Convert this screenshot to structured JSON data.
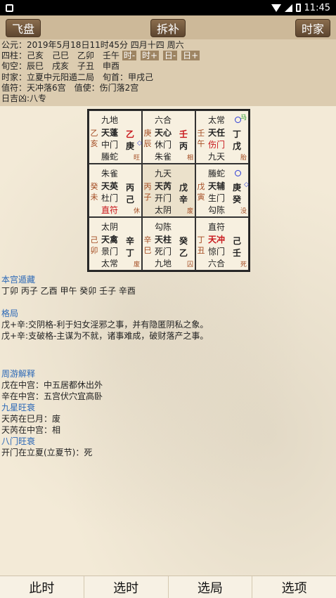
{
  "status": {
    "time": "11:45"
  },
  "topbar": {
    "left_btn": "飞盘",
    "center_btn": "拆补",
    "right_btn": "时家"
  },
  "info": {
    "line1": "公元：2019年5月18日11时45分 四月十四 周六",
    "line2_label": "四柱：己亥　己巳　乙卯　壬午",
    "tags": [
      "时-",
      "时+",
      "日-",
      "日+"
    ],
    "line3": "旬空：辰巳　戌亥　子丑　申酉",
    "line4": "时家：立夏中元阳遁二局　旬首：甲戌己",
    "line5": "值符：天冲落6宫　值使：伤门落2宫",
    "line6": "日吉凶:八专"
  },
  "grid": [
    {
      "side": [
        "乙",
        "亥"
      ],
      "r1": "九地",
      "r2": "天蓬",
      "k2": "乙",
      "r3": "中门",
      "k3": "庚",
      "r4": "螣蛇",
      "status": "旺"
    },
    {
      "side": [
        "庚",
        "辰"
      ],
      "r1": "六合",
      "r2": "天心",
      "k2": "壬",
      "r3": "休门",
      "k3": "丙",
      "r4": "朱雀",
      "status": "相"
    },
    {
      "side": [
        "壬",
        "午"
      ],
      "r1": "太常",
      "r2": "天任",
      "k2": "丁",
      "r3": "伤门",
      "k3": "戊",
      "r4": "九天",
      "status": "胎"
    },
    {
      "side": [
        "癸",
        "未"
      ],
      "r1": "朱雀",
      "r2": "天英",
      "k2": "丙",
      "r3": "杜门",
      "k3": "己",
      "r4": "直符",
      "status": "休"
    },
    {
      "side": [
        "丙",
        "子"
      ],
      "r1": "九天",
      "r2": "天芮",
      "k2": "戊",
      "r3": "开门",
      "k3": "辛",
      "r4": "太阴",
      "status": "废"
    },
    {
      "side": [
        "戊",
        "寅"
      ],
      "r1": "螣蛇",
      "r2": "天辅",
      "k2": "庚",
      "r3": "生门",
      "k3": "癸",
      "r4": "勾陈",
      "status": "没"
    },
    {
      "side": [
        "己",
        "卯"
      ],
      "r1": "太阴",
      "r2": "天禽",
      "k2": "辛",
      "r3": "景门",
      "k3": "丁",
      "r4": "太常",
      "status": "废"
    },
    {
      "side": [
        "辛",
        "巳"
      ],
      "r1": "勾陈",
      "r2": "天柱",
      "k2": "癸",
      "r3": "死门",
      "k3": "乙",
      "r4": "九地",
      "status": "囚"
    },
    {
      "side": [
        "丁",
        "丑"
      ],
      "r1": "直符",
      "r2": "天冲",
      "k2": "己",
      "r3": "惊门",
      "k3": "壬",
      "r4": "六合",
      "status": "死"
    }
  ],
  "text": {
    "h1": "本宫遁藏",
    "p1": "丁卯 丙子 乙酉 甲午 癸卯 壬子 辛酉",
    "h2": "格局",
    "p2a": "戊+辛:交阴格-利于妇女淫邪之事，并有隐匿阴私之象。",
    "p2b": "戊+辛:支破格-主谋为不就，诸事难成，破财落产之事。",
    "h3": "周游解释",
    "p3a": "戊在中宫：中五居都休出外",
    "p3b": "辛在中宫：五宫伏穴宜高卧",
    "h4": "九星旺衰",
    "p4a": "天芮在巳月：废",
    "p4b": "天芮在中宫：相",
    "h5": "八门旺衰",
    "p5a": "开门在立夏(立夏节)：死"
  },
  "bottomnav": {
    "b1": "此时",
    "b2": "选时",
    "b3": "选局",
    "b4": "选项"
  }
}
